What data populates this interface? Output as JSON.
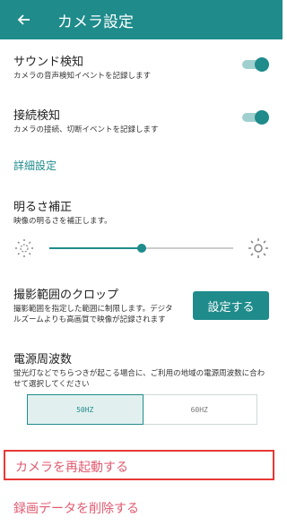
{
  "header": {
    "title": "カメラ設定",
    "back_icon": "arrow-left-icon"
  },
  "settings": {
    "sound": {
      "label": "サウンド検知",
      "desc": "カメラの音声検知イベントを記録します",
      "enabled": true
    },
    "connection": {
      "label": "接続検知",
      "desc": "カメラの接続、切断イベントを記録します",
      "enabled": true
    }
  },
  "advanced": {
    "section_label": "詳細設定",
    "brightness": {
      "label": "明るさ補正",
      "desc": "映像の明るさを補正します。",
      "value": 0.5
    },
    "crop": {
      "label": "撮影範囲のクロップ",
      "desc_line1": "撮影範囲を指定した範囲に制限します。デジタ",
      "desc_line2": "ルズームよりも高画質で映像が記録されます",
      "button": "設定する"
    },
    "frequency": {
      "label": "電源周波数",
      "desc_line1": "蛍光灯などでちらつきが起こる場合に、ご利用の地域の電源周波数に合わ",
      "desc_line2": "せて選択してください",
      "options": [
        "50HZ",
        "60HZ"
      ],
      "selected": "50HZ"
    }
  },
  "actions": {
    "restart": "カメラを再起動する",
    "delete": "録画データを削除する"
  },
  "colors": {
    "primary": "#1f8b8b",
    "danger": "#e05a70",
    "highlight": "#e53935"
  }
}
